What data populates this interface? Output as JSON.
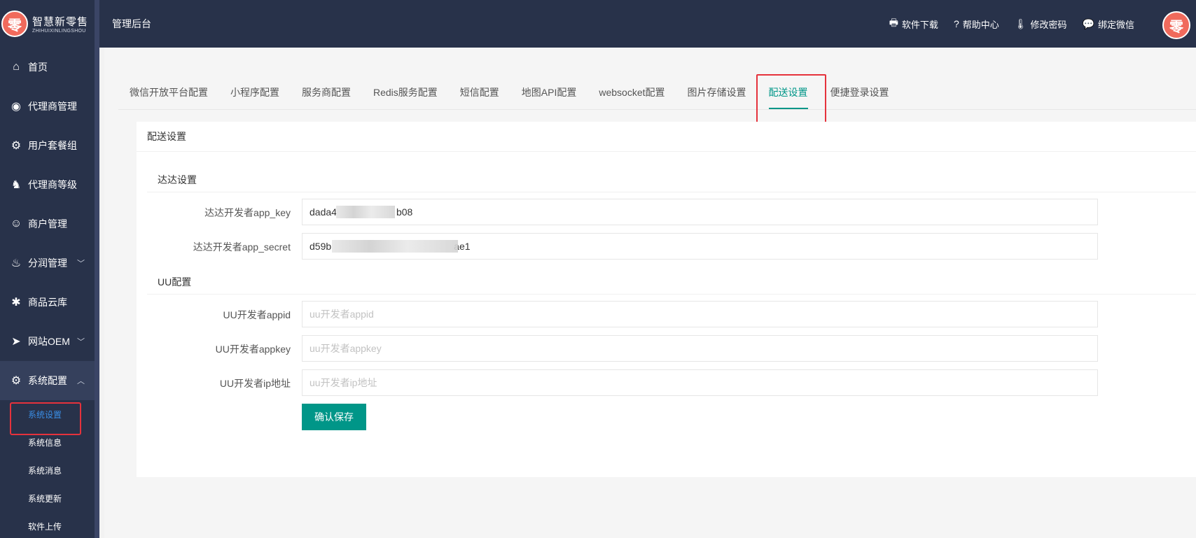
{
  "brand": {
    "name_cn": "智慧新零售",
    "name_en": "ZHIHUIXINLINGSHOU",
    "logo_char": "零"
  },
  "header": {
    "title": "管理后台",
    "tools": [
      {
        "icon": "printer-icon",
        "glyph": "🖶",
        "label": "软件下载"
      },
      {
        "icon": "help-icon",
        "glyph": "?",
        "label": "帮助中心"
      },
      {
        "icon": "thermometer-icon",
        "glyph": "🌡",
        "label": "修改密码"
      },
      {
        "icon": "chat-icon",
        "glyph": "💬",
        "label": "绑定微信"
      }
    ],
    "avatar_char": "零"
  },
  "sidebar": {
    "items": [
      {
        "name": "home",
        "icon": "home-icon",
        "glyph": "⌂",
        "label": "首页"
      },
      {
        "name": "agent-management",
        "icon": "compass-icon",
        "glyph": "◉",
        "label": "代理商管理"
      },
      {
        "name": "user-package-group",
        "icon": "gear-m-icon",
        "glyph": "⚙",
        "label": "用户套餐组"
      },
      {
        "name": "agent-level",
        "icon": "user-tie-icon",
        "glyph": "♞",
        "label": "代理商等级"
      },
      {
        "name": "merchant-management",
        "icon": "user-circle-icon",
        "glyph": "☺",
        "label": "商户管理"
      },
      {
        "name": "profit-sharing",
        "icon": "fire-icon",
        "glyph": "♨",
        "label": "分润管理",
        "chevron": "﹀"
      },
      {
        "name": "product-cloud",
        "icon": "asterisk-icon",
        "glyph": "✱",
        "label": "商品云库"
      },
      {
        "name": "website-oem",
        "icon": "send-icon",
        "glyph": "➤",
        "label": "网站OEM",
        "chevron": "﹀"
      }
    ],
    "system": {
      "icon": "cog-icon",
      "glyph": "⚙",
      "label": "系统配置",
      "chevron": "︿"
    },
    "sub_items": [
      {
        "label": "系统设置",
        "active": true
      },
      {
        "label": "系统信息"
      },
      {
        "label": "系统消息"
      },
      {
        "label": "系统更新"
      },
      {
        "label": "软件上传"
      }
    ]
  },
  "tabs": [
    "微信开放平台配置",
    "小程序配置",
    "服务商配置",
    "Redis服务配置",
    "短信配置",
    "地图API配置",
    "websocket配置",
    "图片存储设置",
    "配送设置",
    "便捷登录设置"
  ],
  "active_tab": "配送设置",
  "card": {
    "title": "配送设置",
    "dada": {
      "section": "达达设置",
      "app_key_label": "达达开发者app_key",
      "app_key_prefix": "dada4",
      "app_key_suffix": "b08",
      "app_secret_label": "达达开发者app_secret",
      "app_secret_prefix": "d59b",
      "app_secret_suffix": "ae1"
    },
    "uu": {
      "section": "UU配置",
      "appid_label": "UU开发者appid",
      "appid_placeholder": "uu开发者appid",
      "appkey_label": "UU开发者appkey",
      "appkey_placeholder": "uu开发者appkey",
      "ip_label": "UU开发者ip地址",
      "ip_placeholder": "uu开发者ip地址"
    },
    "save_label": "确认保存"
  },
  "colors": {
    "sidebar": "#28324a",
    "accent": "#009688",
    "highlight": "#e5323c",
    "active_link": "#3a8ee6"
  }
}
